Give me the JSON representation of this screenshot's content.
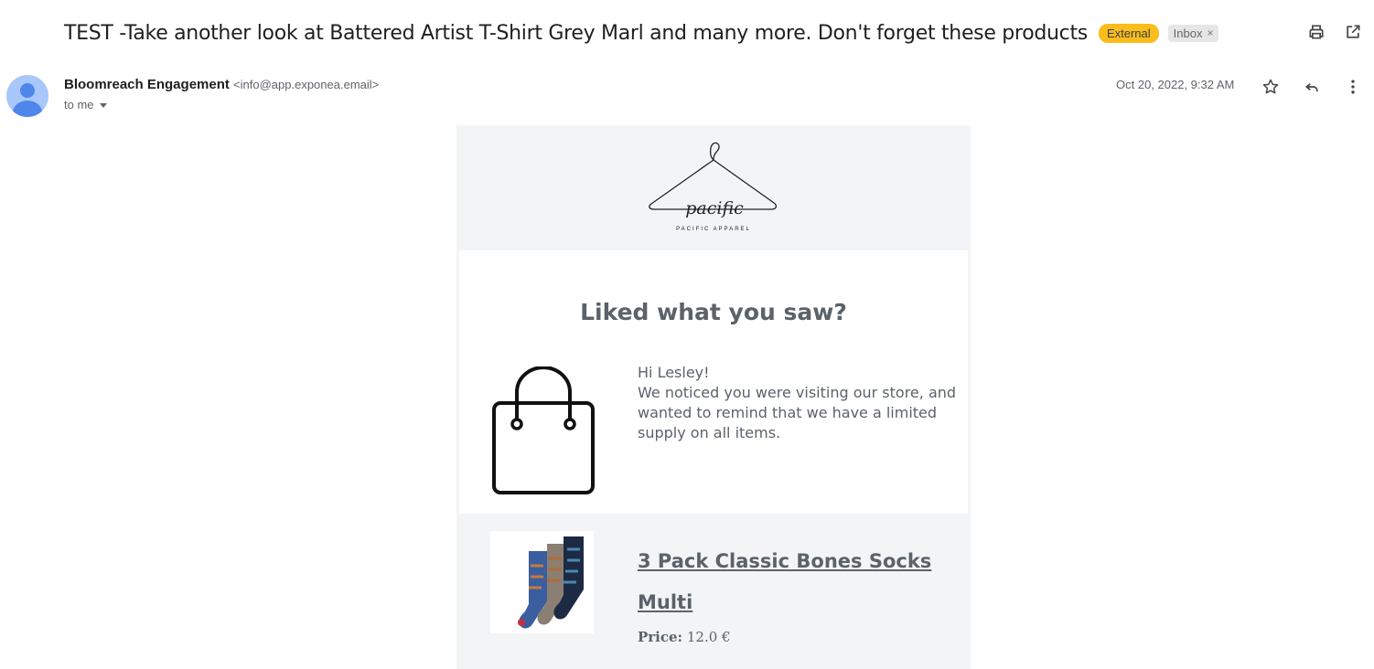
{
  "subject": "TEST -Take another look at Battered Artist T-Shirt Grey Marl and many more. Don't forget these products",
  "labels": {
    "external": "External",
    "inbox": "Inbox",
    "inbox_remove": "×"
  },
  "sender": {
    "name": "Bloomreach Engagement",
    "email": "<info@app.exponea.email>",
    "recipient": "to me"
  },
  "date": "Oct 20, 2022, 9:32 AM",
  "icons": [
    "print-icon",
    "open-in-new-window-icon",
    "star-icon",
    "reply-icon",
    "more-vert-icon",
    "avatar-icon",
    "shopping-bag-icon"
  ],
  "email": {
    "brand_logo_text": "pacific",
    "brand_sub": "PACIFIC APPAREL",
    "headline": "Liked what you saw?",
    "greeting": "Hi Lesley!",
    "message": "We noticed you were visiting our store, and wanted to remind that we have a limited supply on all items.",
    "product": {
      "name": "3 Pack Classic Bones Socks Multi",
      "price_label": "Price:",
      "price_value": "12.0 €"
    }
  },
  "colors": {
    "external_badge": "#f9bd1c",
    "email_text": "#5b6269",
    "email_bg": "#f3f4f6"
  }
}
